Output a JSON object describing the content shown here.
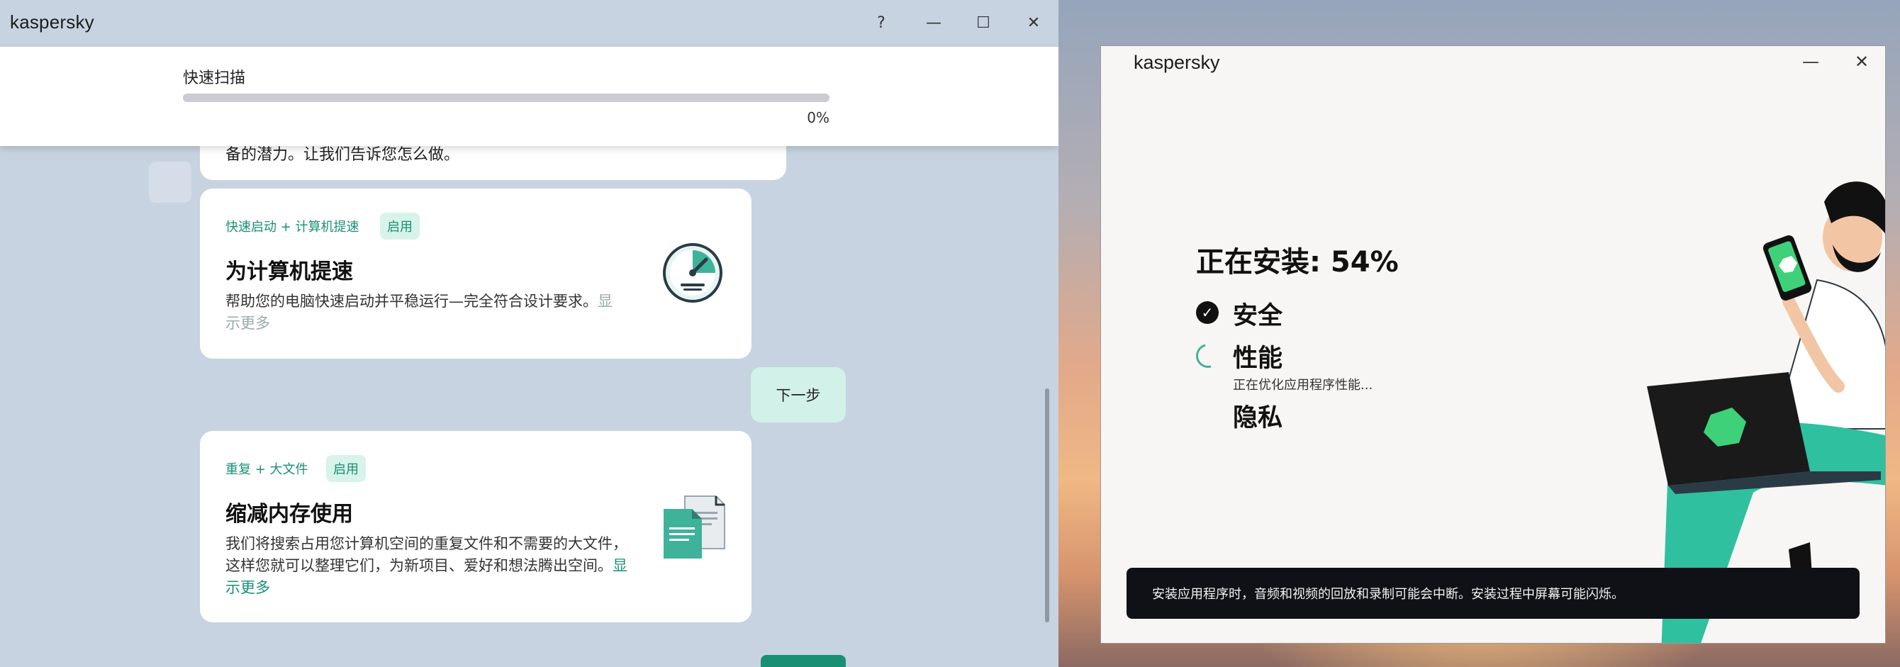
{
  "left_window": {
    "brand": "kaspersky",
    "controls": {
      "help": "?",
      "minimize": "—",
      "maximize": "☐",
      "close": "✕"
    },
    "scan": {
      "title": "快速扫描",
      "progress_label": "0%",
      "progress": 0
    },
    "prev_card_text": "备的潜力。让我们告诉您怎么做。",
    "card1": {
      "tag": "快速启动 + 计算机提速",
      "badge": "启用",
      "title": "为计算机提速",
      "desc": "帮助您的电脑快速启动并平稳运行—完全符合设计要求。",
      "more": "显示更多",
      "icon": "speedometer-icon"
    },
    "next_button": "下一步",
    "card2": {
      "tag": "重复 + 大文件",
      "badge": "启用",
      "title": "缩减内存使用",
      "desc": "我们将搜索占用您计算机空间的重复文件和不需要的大文件，这样您就可以整理它们，为新项目、爱好和想法腾出空间。",
      "more": "显示更多",
      "icon": "documents-icon"
    }
  },
  "installer": {
    "brand": "kaspersky",
    "controls": {
      "minimize": "—",
      "close": "✕"
    },
    "heading": "正在安装: 54%",
    "steps": [
      {
        "label": "安全",
        "status": "done"
      },
      {
        "label": "性能",
        "status": "in-progress",
        "sub": "正在优化应用程序性能..."
      },
      {
        "label": "隐私",
        "status": "pending"
      }
    ],
    "notice": "安装应用程序时，音频和视频的回放和录制可能会中断。安装过程中屏幕可能闪烁。",
    "colors": {
      "accent": "#3fb29a",
      "notice_bg": "#101116"
    }
  }
}
